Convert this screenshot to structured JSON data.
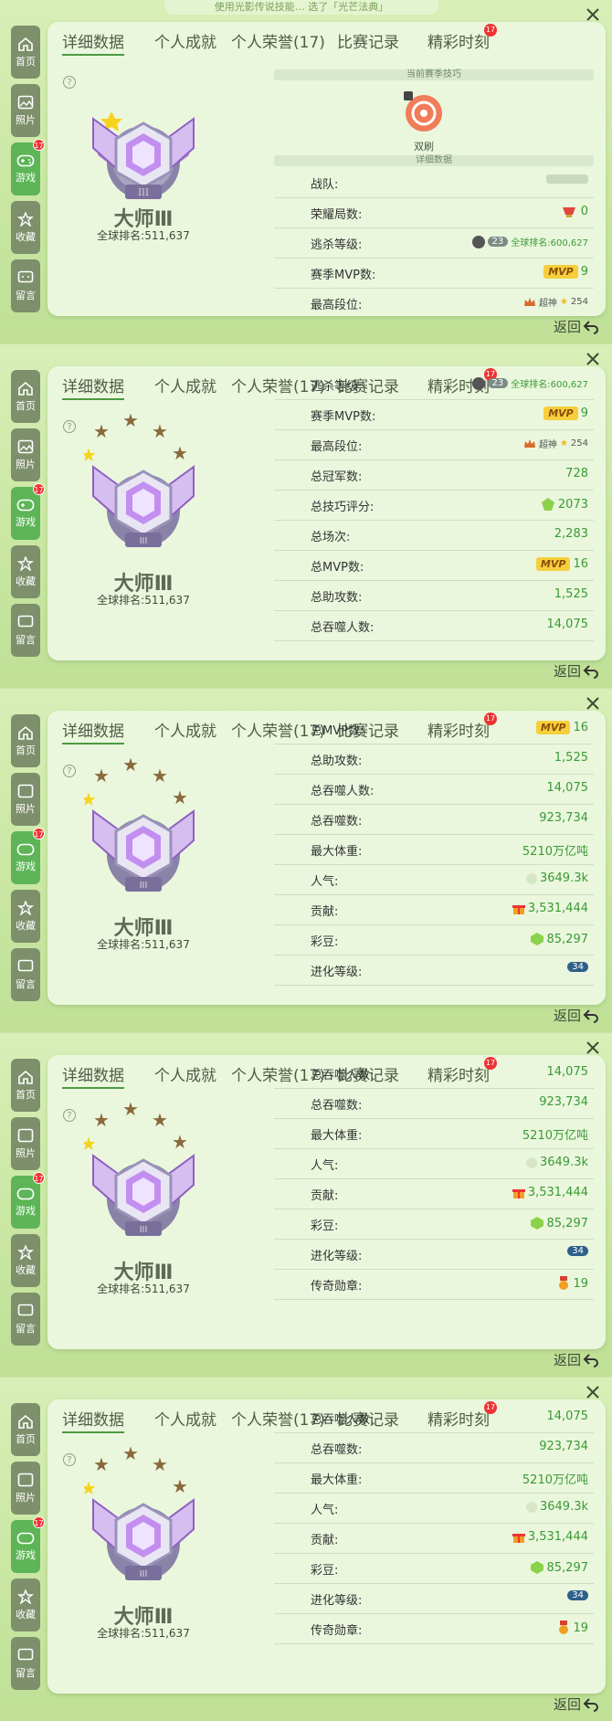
{
  "colors": {
    "accent": "#5db557",
    "value": "#3a9a35",
    "mvp": "#f6cf3d"
  },
  "top_notice": "使用光影传说技能…  选了「光芒法典」",
  "sidebar": [
    {
      "label": "首页",
      "icon": "home-icon"
    },
    {
      "label": "照片",
      "icon": "photo-icon"
    },
    {
      "label": "游戏",
      "icon": "gamepad-icon",
      "badge": "17"
    },
    {
      "label": "收藏",
      "icon": "collect-icon"
    },
    {
      "label": "留言",
      "icon": "message-icon"
    }
  ],
  "tabs": [
    {
      "label": "详细数据"
    },
    {
      "label": "个人成就"
    },
    {
      "label": "个人荣誉(17)"
    },
    {
      "label": "比赛记录"
    },
    {
      "label": "精彩时刻",
      "badge": "17"
    }
  ],
  "help": "?",
  "rank": {
    "name": "大师Ⅲ",
    "global_rank": "全球排名:511,637",
    "emblem_roman": "III"
  },
  "back": "返回",
  "skill_section": {
    "header": "当前赛季技巧",
    "skill_name": "双刷",
    "detail_header": "详细数据"
  },
  "stats": {
    "team": {
      "label": "战队:",
      "value": ""
    },
    "honor": {
      "label": "荣耀局数:",
      "value": "0"
    },
    "kill_level": {
      "label": "逃杀等级:",
      "level": "23",
      "extra": "全球排名:600,627"
    },
    "season_mvp": {
      "label": "赛季MVP数:",
      "badge": "MVP",
      "value": "9"
    },
    "top_rank": {
      "label": "最高段位:",
      "tier": "超神",
      "stars": "254"
    },
    "champ": {
      "label": "总冠军数:",
      "value": "728"
    },
    "skill_score": {
      "label": "总技巧评分:",
      "value": "2073"
    },
    "games": {
      "label": "总场次:",
      "value": "2,283"
    },
    "total_mvp": {
      "label": "总MVP数:",
      "badge": "MVP",
      "value": "16"
    },
    "assists": {
      "label": "总助攻数:",
      "value": "1,525"
    },
    "eaten_players": {
      "label": "总吞噬人数:",
      "value": "14,075"
    },
    "eaten": {
      "label": "总吞噬数:",
      "value": "923,734"
    },
    "max_weight": {
      "label": "最大体重:",
      "value": "5210万亿吨"
    },
    "popularity": {
      "label": "人气:",
      "value": "3649.3k"
    },
    "contribution": {
      "label": "贡献:",
      "value": "3,531,444"
    },
    "beans": {
      "label": "彩豆:",
      "value": "85,297"
    },
    "evolve": {
      "label": "进化等级:",
      "value": "34"
    },
    "legend_medal": {
      "label": "传奇勋章:",
      "value": "19"
    }
  }
}
